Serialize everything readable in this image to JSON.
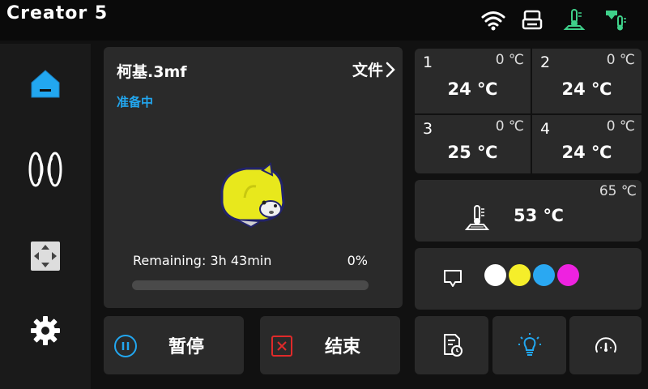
{
  "app": {
    "title": "Creator 5"
  },
  "status_icons": [
    "wifi-icon",
    "printer-icon",
    "bed-heating-icon",
    "nozzle-heating-icon"
  ],
  "sidebar": {
    "items": [
      {
        "icon": "home-icon",
        "active": true
      },
      {
        "icon": "filament-spool-icon",
        "active": false
      },
      {
        "icon": "move-axis-icon",
        "active": false
      },
      {
        "icon": "settings-icon",
        "active": false
      }
    ]
  },
  "job": {
    "filename": "柯基.3mf",
    "files_label": "文件",
    "status": "准备中",
    "remaining": "Remaining: 3h 43min",
    "progress_text": "0%",
    "progress_value": 0
  },
  "controls": {
    "pause_label": "暂停",
    "stop_label": "结束"
  },
  "extruders": [
    {
      "num": "1",
      "target": "0 ℃",
      "temp": "24 ℃"
    },
    {
      "num": "2",
      "target": "0 ℃",
      "temp": "24 ℃"
    },
    {
      "num": "3",
      "target": "0 ℃",
      "temp": "25 ℃"
    },
    {
      "num": "4",
      "target": "0 ℃",
      "temp": "24 ℃"
    }
  ],
  "bed": {
    "target": "65 ℃",
    "temp": "53 ℃"
  },
  "materials": {
    "colors": [
      "#ffffff",
      "#f5ee2a",
      "#2aa8f2",
      "#ee22e0"
    ]
  },
  "colors": {
    "accent": "#22a7f0",
    "stop_red": "#e02a2a",
    "icon_green": "#3fd08a"
  }
}
